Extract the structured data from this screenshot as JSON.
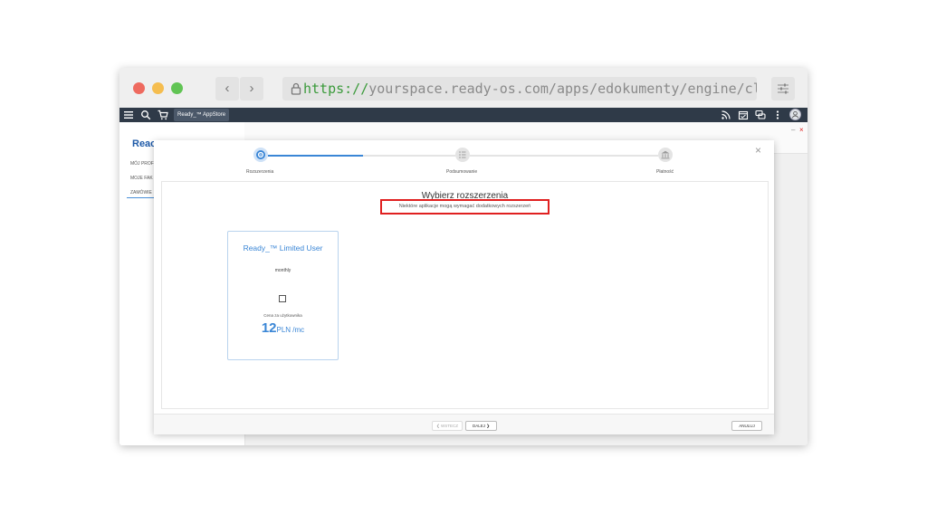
{
  "browser": {
    "url_protocol": "https://",
    "url_rest": "yourspace.ready-os.com/apps/edokumenty/engine/cloud/",
    "back_glyph": "‹",
    "forward_glyph": "›"
  },
  "toolbar": {
    "app_tab_label": "Ready_™ AppStore",
    "icons": [
      "menu-icon",
      "search-icon",
      "cart-icon",
      "rss-icon",
      "calendar-icon",
      "chat-icon",
      "more-icon",
      "avatar-icon"
    ]
  },
  "window_controls": {
    "minimize": "–",
    "close": "×"
  },
  "sidebar": {
    "brand": "Reac",
    "items": [
      "MÓJ PROF",
      "MOJE FAK",
      "ZAMÓWIE"
    ]
  },
  "modal": {
    "close_glyph": "×",
    "steps": [
      {
        "label": "Rozszerzenia",
        "state": "active"
      },
      {
        "label": "Podsumowanie",
        "state": "inactive"
      },
      {
        "label": "Płatność",
        "state": "inactive"
      }
    ],
    "title": "Wybierz rozszerzenia",
    "notice": "Niektóre aplikacje mogą wymagać dodatkowych rozszerzeń",
    "card": {
      "title": "Ready_™ Limited User",
      "period": "monthly",
      "checked": false,
      "price_label": "Cena za użytkownika",
      "price_value": "12",
      "price_unit": "PLN /mc"
    },
    "footer": {
      "back_label": "❮ WSTECZ",
      "next_label": "DALEJ ❯",
      "cancel_label": "ANULUJ"
    }
  },
  "colors": {
    "accent": "#3a86d6",
    "toolbar": "#2f3a48",
    "notice_border": "#e02020",
    "url_protocol": "#3a9a3a"
  }
}
